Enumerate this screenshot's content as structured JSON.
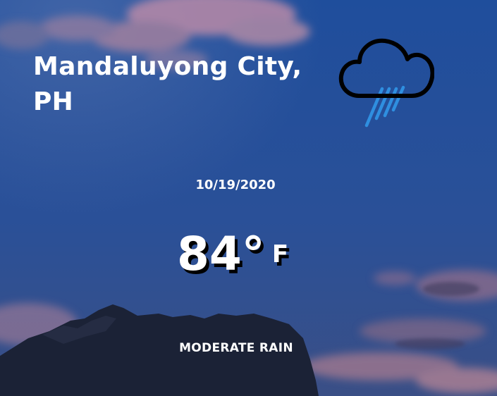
{
  "location": {
    "city": "Mandaluyong City, PH"
  },
  "forecast": {
    "date": "10/19/2020",
    "temperature": "84°",
    "unit": "F",
    "description": "MODERATE RAIN",
    "condition_icon": "rain-cloud-icon"
  },
  "colors": {
    "sky_top": "#1e4f9e",
    "sky_bottom": "#2e4f88",
    "cloud_pink": "#c18aa7",
    "mountain": "#1a2236",
    "rain_streak": "#2f8fe0",
    "text": "#ffffff",
    "shadow": "#000000"
  }
}
